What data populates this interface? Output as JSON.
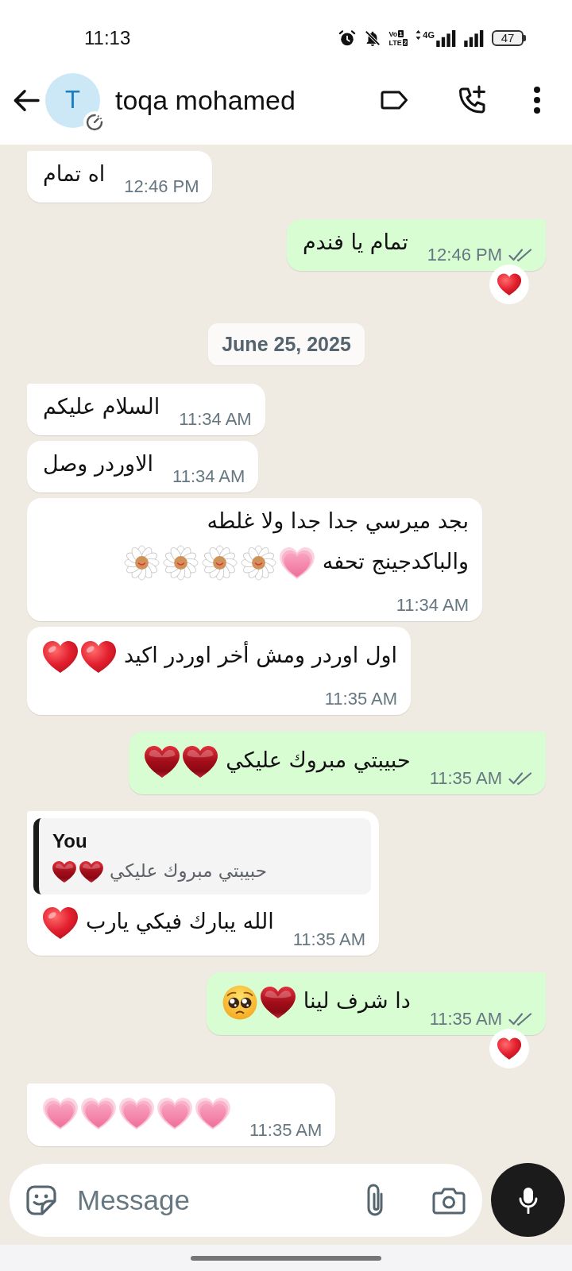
{
  "status_bar": {
    "time": "11:13",
    "volte": [
      {
        "label": "Vo",
        "sim": "1"
      },
      {
        "label": "LTE",
        "sim": "2"
      }
    ],
    "network": "4G",
    "battery": "47"
  },
  "header": {
    "avatar_initial": "T",
    "name": "toqa mohamed"
  },
  "messages": [
    {
      "kind": "message",
      "outgoing": false,
      "lines": [
        {
          "text": "اه تمام"
        }
      ],
      "time": "12:46 PM"
    },
    {
      "kind": "message",
      "outgoing": true,
      "lines": [
        {
          "text": "تمام يا فندم"
        }
      ],
      "time": "12:46 PM",
      "read": false,
      "reaction": {
        "kind": "red-heart"
      }
    },
    {
      "kind": "date",
      "text": "June 25, 2025"
    },
    {
      "kind": "message",
      "outgoing": false,
      "lines": [
        {
          "text": "السلام عليكم"
        }
      ],
      "time": "11:34 AM"
    },
    {
      "kind": "message",
      "outgoing": false,
      "lines": [
        {
          "text": "الاوردر وصل"
        }
      ],
      "time": "11:34 AM"
    },
    {
      "kind": "message",
      "outgoing": false,
      "lines": [
        {
          "text": "بجد ميرسي جدا جدا ولا غلطه"
        },
        {
          "text": "والباكدجينج تحفه",
          "emojis": [
            {
              "kind": "growing-heart"
            },
            {
              "kind": "daisy"
            },
            {
              "kind": "daisy"
            },
            {
              "kind": "daisy"
            },
            {
              "kind": "daisy"
            }
          ]
        }
      ],
      "time": "11:34 AM"
    },
    {
      "kind": "message",
      "outgoing": false,
      "lines": [
        {
          "text": "اول اوردر ومش أخر اوردر اكيد",
          "emojis": [
            {
              "kind": "red-heart"
            },
            {
              "kind": "red-heart"
            }
          ]
        }
      ],
      "time": "11:35 AM"
    },
    {
      "kind": "message",
      "outgoing": true,
      "lines": [
        {
          "text": "حبيبتي مبروك عليكي",
          "emojis": [
            {
              "kind": "heart-suit"
            },
            {
              "kind": "heart-suit"
            }
          ]
        }
      ],
      "time": "11:35 AM",
      "read": false
    },
    {
      "kind": "message",
      "outgoing": false,
      "quote": {
        "author": "You",
        "text": "حبيبتي مبروك عليكي",
        "emojis": [
          {
            "kind": "heart-suit"
          },
          {
            "kind": "heart-suit"
          }
        ]
      },
      "lines": [
        {
          "text": "الله يبارك فيكي يارب",
          "emojis": [
            {
              "kind": "red-heart"
            }
          ]
        }
      ],
      "time": "11:35 AM"
    },
    {
      "kind": "message",
      "outgoing": true,
      "lines": [
        {
          "text": "دا شرف لينا",
          "emojis": [
            {
              "kind": "heart-suit"
            },
            {
              "kind": "pleading-face"
            }
          ]
        }
      ],
      "time": "11:35 AM",
      "read": false,
      "reaction": {
        "kind": "red-heart"
      }
    },
    {
      "kind": "message",
      "outgoing": false,
      "lines": [
        {
          "emojis": [
            {
              "kind": "growing-heart"
            },
            {
              "kind": "growing-heart"
            },
            {
              "kind": "growing-heart"
            },
            {
              "kind": "growing-heart"
            },
            {
              "kind": "growing-heart"
            }
          ]
        }
      ],
      "time": "11:35 AM"
    }
  ],
  "composer": {
    "placeholder": "Message"
  }
}
